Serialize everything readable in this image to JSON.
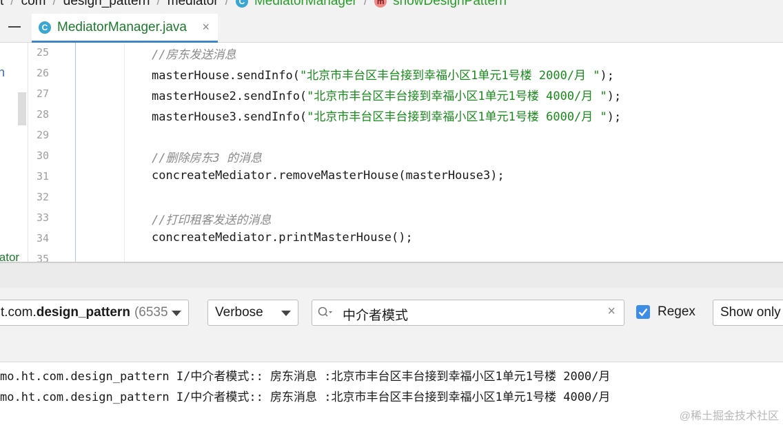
{
  "breadcrumb": {
    "items": [
      "t",
      "com",
      "design_pattern",
      "mediator",
      "MediatorManager",
      "showDesignPattern"
    ]
  },
  "tab": {
    "icon_letter": "C",
    "label": "MediatorManager.java",
    "close": "×"
  },
  "sidebar": {
    "fragment_top": "n",
    "fragment_bottom": "iator"
  },
  "editor": {
    "line_numbers": [
      "25",
      "26",
      "27",
      "28",
      "29",
      "30",
      "31",
      "32",
      "33",
      "34",
      "35"
    ],
    "lines": {
      "l25_comment": "//房东发送消息",
      "l26_prefix": "masterHouse.sendInfo(",
      "l26_string": "\"北京市丰台区丰台接到幸福小区1单元1号楼 2000/月 \"",
      "l26_suffix": ");",
      "l27_prefix": "masterHouse2.sendInfo(",
      "l27_string": "\"北京市丰台区丰台接到幸福小区1单元1号楼 4000/月 \"",
      "l27_suffix": ");",
      "l28_prefix": "masterHouse3.sendInfo(",
      "l28_string": "\"北京市丰台区丰台接到幸福小区1单元1号楼 6000/月 \"",
      "l28_suffix": ");",
      "l30_comment": "//删除房东3 的消息",
      "l31_code": "concreateMediator.removeMasterHouse(masterHouse3);",
      "l33_comment": "//打印租客发送的消息",
      "l34_code": "concreateMediator.printMasterHouse();"
    }
  },
  "logcat": {
    "process": {
      "prefix": "t.com.",
      "bold": "design_pattern",
      "pid": "(6535"
    },
    "level": "Verbose",
    "search": {
      "value": "中介者模式",
      "clear": "×"
    },
    "regex": {
      "checked": true,
      "label": "Regex"
    },
    "filter": "Show only",
    "lines": [
      "mo.ht.com.design_pattern I/中介者模式:: 房东消息 :北京市丰台区丰台接到幸福小区1单元1号楼 2000/月",
      "mo.ht.com.design_pattern I/中介者模式:: 房东消息 :北京市丰台区丰台接到幸福小区1单元1号楼 4000/月"
    ]
  },
  "watermark": "@稀土掘金技术社区",
  "colors": {
    "accent": "#4083c9",
    "checkbox": "#3d8ce6",
    "string": "#188a1a",
    "comment": "#8a8a8a",
    "file_green": "#1d7a2d"
  }
}
